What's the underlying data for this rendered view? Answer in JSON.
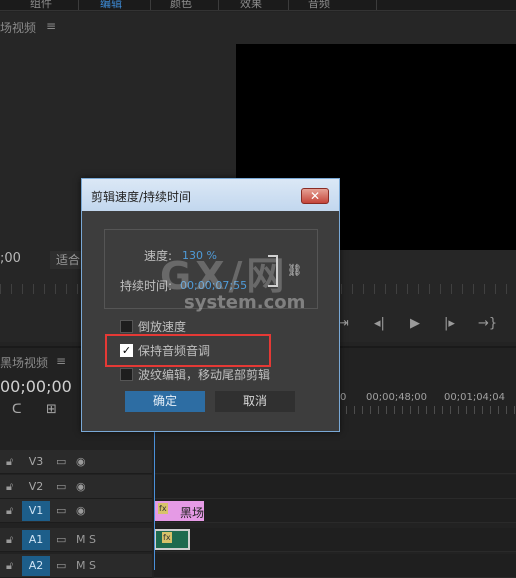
{
  "top_tabs": [
    "组件",
    "编辑",
    "颜色",
    "效果",
    "音频"
  ],
  "source_panel": {
    "title": "场视频",
    "menu": "≡",
    "timecode": ";00",
    "fit": "适合"
  },
  "transport": {
    "mark_out": "⇥",
    "step_back": "◂|",
    "play": "▶",
    "step_fwd": "|▸",
    "insert": "→}"
  },
  "timeline": {
    "title": "黑场视频",
    "menu": "≡",
    "timecode": "00;00;00",
    "ruler_times": [
      "0",
      "00;00;48;00",
      "00;01;04;04"
    ],
    "tracks": [
      {
        "name": "V3",
        "selected": false,
        "extra": ""
      },
      {
        "name": "V2",
        "selected": false,
        "extra": ""
      },
      {
        "name": "V1",
        "selected": true,
        "extra": ""
      },
      {
        "name": "A1",
        "selected": true,
        "extra": "M  S"
      },
      {
        "name": "A2",
        "selected": true,
        "extra": "M  S"
      }
    ],
    "clip_v1_label": "黑场",
    "fx_label": "fx"
  },
  "dialog": {
    "title": "剪辑速度/持续时间",
    "close": "✕",
    "speed_label": "速度:",
    "speed_value": "130 %",
    "duration_label": "持续时间:",
    "duration_value": "00;00;07;55",
    "link_icon": "⛓",
    "reverse_label": "倒放速度",
    "reverse_checked": false,
    "maintain_pitch_label": "保持音频音调",
    "maintain_pitch_checked": true,
    "ripple_label": "波纹编辑，移动尾部剪辑",
    "ripple_checked": false,
    "ok_label": "确定",
    "cancel_label": "取消"
  },
  "watermark": {
    "main": "GX/网",
    "sub": "system.com"
  }
}
